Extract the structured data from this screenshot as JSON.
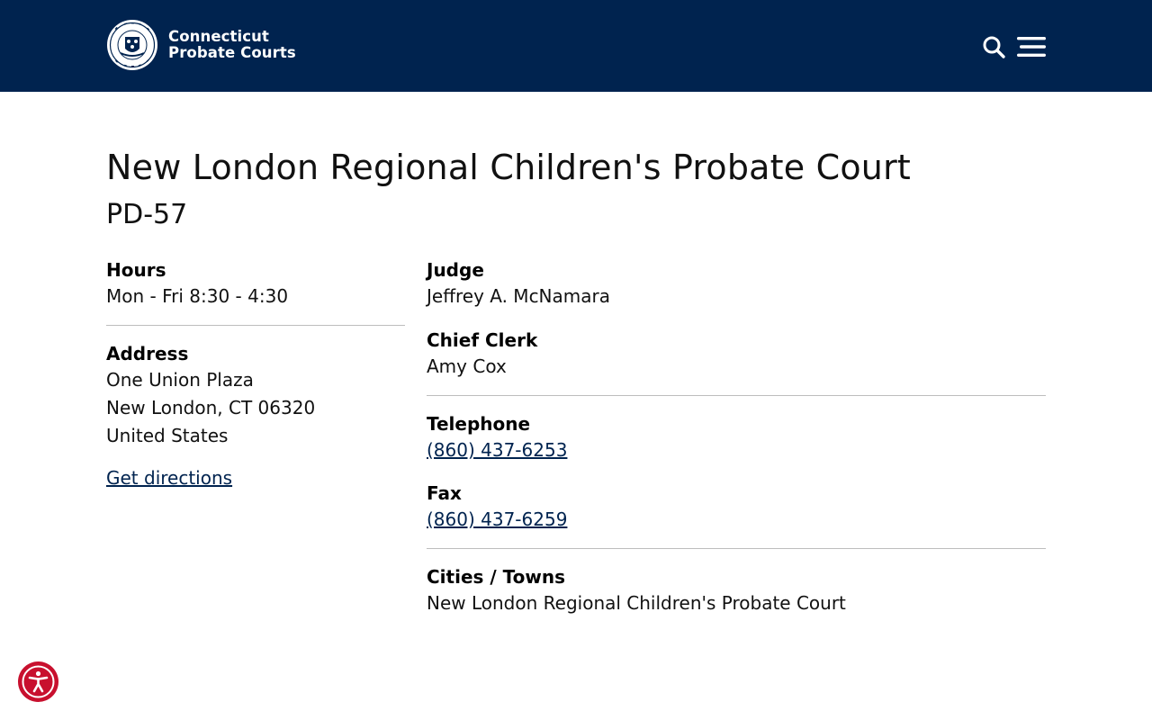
{
  "header": {
    "logo": {
      "line1": "Connecticut",
      "line2": "Probate Courts",
      "seal_text": "CONNECTICUT PROBATE COURTS",
      "icon": "state-seal-icon"
    },
    "search_icon": "search-icon",
    "menu_icon": "hamburger-menu-icon",
    "background_color": "#00234f"
  },
  "page": {
    "title": "New London Regional Children's Probate Court",
    "district_code": "PD-57"
  },
  "left_column": {
    "hours": {
      "label": "Hours",
      "value": "Mon - Fri 8:30 - 4:30"
    },
    "address": {
      "label": "Address",
      "line1": "One Union Plaza",
      "line2": "New London, CT 06320",
      "line3": "United States"
    },
    "directions_link": "Get directions"
  },
  "right_column": {
    "judge": {
      "label": "Judge",
      "value": "Jeffrey A. McNamara"
    },
    "chief_clerk": {
      "label": "Chief Clerk",
      "value": "Amy Cox"
    },
    "telephone": {
      "label": "Telephone",
      "value": "(860) 437-6253"
    },
    "fax": {
      "label": "Fax",
      "value": "(860) 437-6259"
    },
    "cities_towns": {
      "label": "Cities / Towns",
      "value": "New London Regional Children's Probate Court"
    }
  },
  "accessibility_widget": {
    "icon": "accessibility-person-icon",
    "color": "#c8102e"
  },
  "colors": {
    "link": "#00234f",
    "divider": "#bdbdbd"
  }
}
